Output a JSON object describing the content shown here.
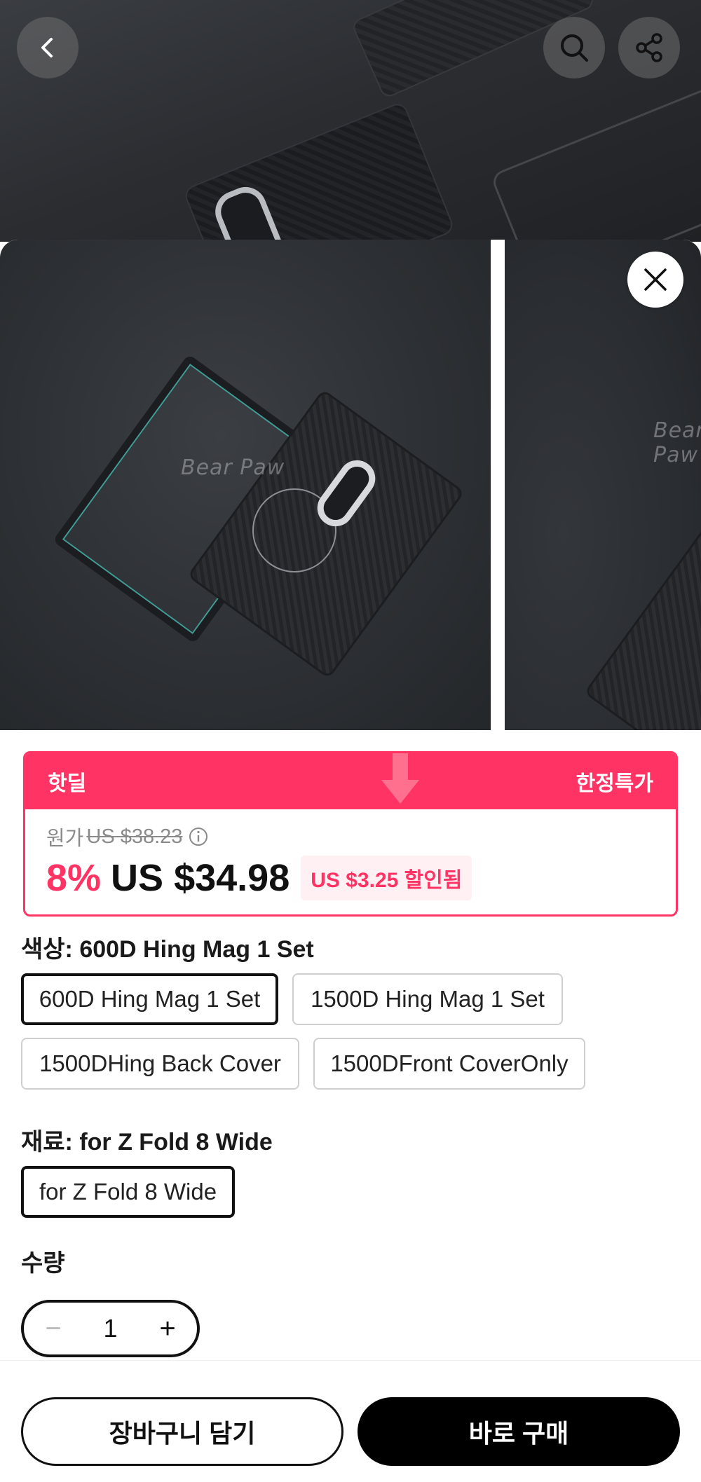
{
  "background_page": {
    "back_icon": "chevron-left-icon",
    "search_icon": "search-icon",
    "share_icon": "share-icon"
  },
  "sheet": {
    "close_icon": "close-icon",
    "gallery": {
      "watermark_text": "Bear Paw"
    },
    "deal": {
      "label_left": "핫딜",
      "label_right": "한정특가",
      "original_label": "원가",
      "original_price": "US $38.23",
      "discount_percent": "8%",
      "sale_price": "US $34.98",
      "saved_badge": "US $3.25 할인됨",
      "accent_color": "#ff3465"
    },
    "color_option": {
      "title": "색상: 600D Hing Mag 1 Set",
      "options": [
        "600D Hing Mag 1 Set",
        "1500D Hing Mag 1 Set",
        "1500DHing Back Cover",
        "1500DFront CoverOnly"
      ],
      "selected": "600D Hing Mag 1 Set"
    },
    "material_option": {
      "title": "재료: for Z Fold 8 Wide",
      "options": [
        "for Z Fold 8 Wide"
      ],
      "selected": "for Z Fold 8 Wide"
    },
    "quantity": {
      "title": "수량",
      "value": "1",
      "minus": "−",
      "plus": "+"
    },
    "actions": {
      "add_to_cart": "장바구니 담기",
      "buy_now": "바로 구매"
    }
  }
}
